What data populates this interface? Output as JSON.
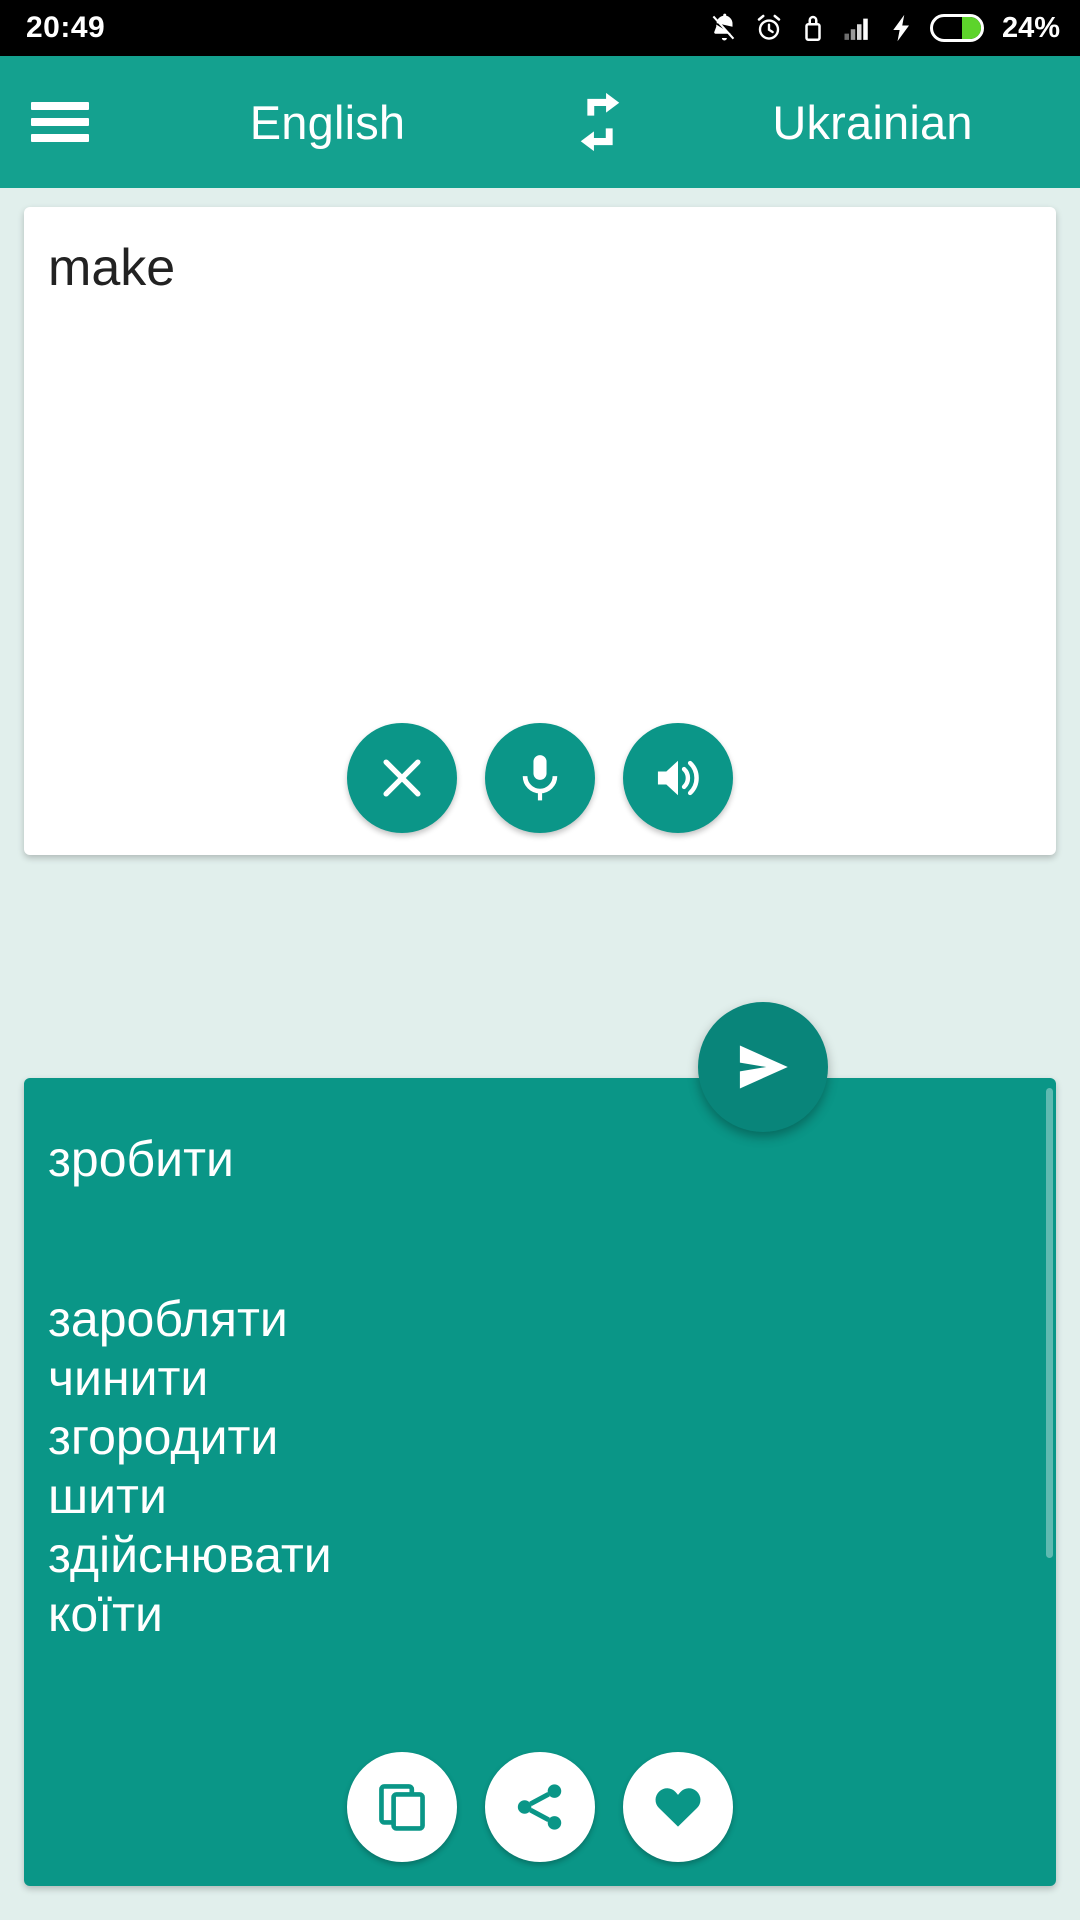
{
  "statusbar": {
    "time": "20:49",
    "battery_percent": "24%",
    "icons": [
      "notifications-off-icon",
      "alarm-icon",
      "usb-icon",
      "signal-icon",
      "charging-bolt-icon",
      "battery-icon"
    ],
    "battery_fill_color": "#5DD42B",
    "background": "#000000"
  },
  "appbar": {
    "menu_label": "menu-icon",
    "source_language": "English",
    "swap_label": "swap-languages-icon",
    "target_language": "Ukrainian",
    "background": "#14A18F",
    "text_color": "#FFFFFF"
  },
  "input_card": {
    "text": "make",
    "placeholder": "",
    "background": "#FFFFFF",
    "buttons": [
      {
        "name": "clear-button",
        "icon": "close-icon",
        "label": "Clear"
      },
      {
        "name": "voice-input-button",
        "icon": "microphone-icon",
        "label": "Voice input"
      },
      {
        "name": "speak-source-button",
        "icon": "speaker-icon",
        "label": "Listen"
      }
    ]
  },
  "send_fab": {
    "name": "translate-send-button",
    "icon": "send-icon",
    "label": "Translate",
    "color": "#09857A"
  },
  "output_card": {
    "background": "#0A9687",
    "translation": "зробити",
    "synonyms": [
      "заробляти",
      "чинити",
      "згородити",
      "шити",
      "здійснювати",
      "коїти"
    ],
    "buttons": [
      {
        "name": "copy-button",
        "icon": "copy-icon",
        "label": "Copy"
      },
      {
        "name": "share-button",
        "icon": "share-icon",
        "label": "Share"
      },
      {
        "name": "favorite-button",
        "icon": "heart-icon",
        "label": "Favorite"
      }
    ]
  },
  "theme": {
    "accent": "#0A9687",
    "appbar": "#14A18F",
    "page_background": "#E1EFEC",
    "fab": "#09857A"
  }
}
